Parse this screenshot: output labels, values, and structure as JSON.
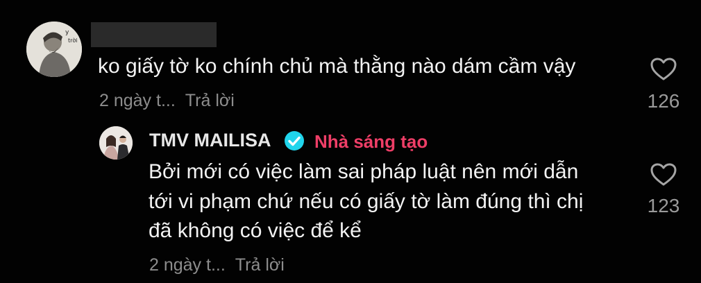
{
  "comment": {
    "avatar_icon": "user-avatar-photo",
    "text": "ko giấy tờ ko chính chủ mà thằng nào dám cầm vậy",
    "time": "2 ngày t...",
    "reply_label": "Trả lời",
    "like_count": "126",
    "like_icon": "heart-outline-icon"
  },
  "reply": {
    "avatar_icon": "creator-avatar-photo",
    "author": "TMV MAILISA",
    "verified_icon": "verified-badge-icon",
    "badge_color": "#20d5ec",
    "creator_label": "Nhà sáng tạo",
    "creator_color": "#ee3e67",
    "lines": [
      "Bởi mới có việc làm sai pháp luật nên mới dẫn",
      "tới vi phạm chứ nếu có giấy tờ làm đúng thì chị",
      "đã không có việc để kể"
    ],
    "time": "2 ngày t...",
    "reply_label": "Trả lời",
    "like_count": "123",
    "like_icon": "heart-outline-icon"
  }
}
